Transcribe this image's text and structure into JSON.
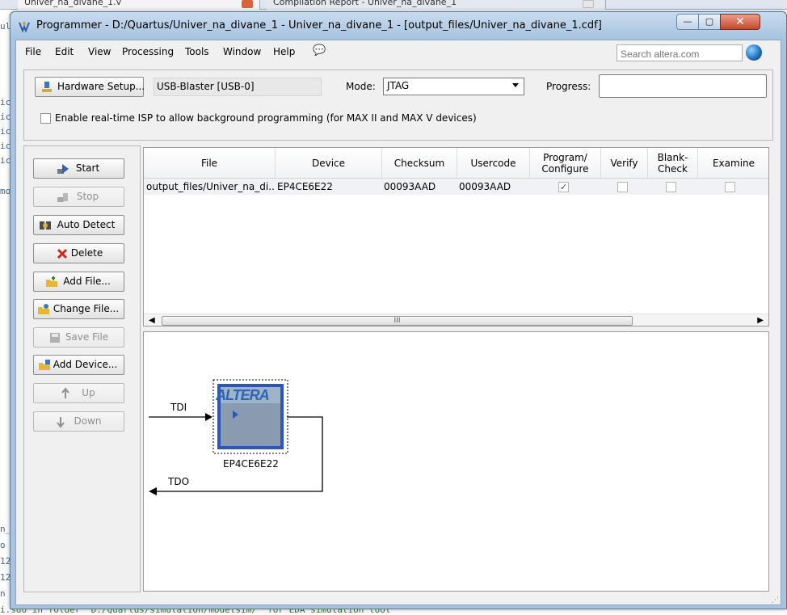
{
  "background": {
    "tab1_label": "Univer_na_divane_1.v",
    "tab2_label": "Compilation Report - Univer_na_divane_1",
    "left_gutter": [
      "ul",
      "ic",
      "ic",
      "ic",
      "ic",
      "ic",
      "mo",
      "n_",
      "o",
      "12",
      "12",
      "n"
    ],
    "console_line": "i.sdo in folder \"D:/Quartus/simulation/modelsim/\" for EDA simulation tool"
  },
  "window": {
    "title": "Programmer - D:/Quartus/Univer_na_divane_1 - Univer_na_divane_1 - [output_files/Univer_na_divane_1.cdf]",
    "min_glyph": "—",
    "max_glyph": "▢",
    "close_glyph": "✕"
  },
  "menu": {
    "items": [
      "File",
      "Edit",
      "View",
      "Processing",
      "Tools",
      "Window",
      "Help"
    ],
    "help_icon": "💬",
    "search_placeholder": "Search altera.com"
  },
  "toolbar": {
    "hardware_setup_label": "Hardware Setup...",
    "hardware_value": "USB-Blaster [USB-0]",
    "mode_label": "Mode:",
    "mode_value": "JTAG",
    "progress_label": "Progress:",
    "progress_value": 0,
    "isp_label": "Enable real-time ISP to allow background programming (for MAX II and MAX V devices)",
    "isp_checked": false
  },
  "side_buttons": [
    {
      "label": "Start",
      "enabled": true,
      "icon": "start-icon"
    },
    {
      "label": "Stop",
      "enabled": false,
      "icon": "stop-icon"
    },
    {
      "label": "Auto Detect",
      "enabled": true,
      "icon": "auto-detect-icon"
    },
    {
      "label": "Delete",
      "enabled": true,
      "icon": "delete-icon"
    },
    {
      "label": "Add File...",
      "enabled": true,
      "icon": "add-file-icon"
    },
    {
      "label": "Change File...",
      "enabled": true,
      "icon": "change-file-icon"
    },
    {
      "label": "Save File",
      "enabled": false,
      "icon": "save-file-icon"
    },
    {
      "label": "Add Device...",
      "enabled": true,
      "icon": "add-device-icon"
    },
    {
      "label": "Up",
      "enabled": false,
      "icon": "up-icon"
    },
    {
      "label": "Down",
      "enabled": false,
      "icon": "down-icon"
    }
  ],
  "table": {
    "headers": [
      "File",
      "Device",
      "Checksum",
      "Usercode",
      "Program/\nConfigure",
      "Verify",
      "Blank-\nCheck",
      "Examine"
    ],
    "rows": [
      {
        "file": "output_files/Univer_na_di...",
        "device": "EP4CE6E22",
        "checksum": "00093AAD",
        "usercode": "00093AAD",
        "program": true,
        "verify": false,
        "blank_check": false,
        "examine": false
      }
    ],
    "scroll_grip": "III"
  },
  "chain": {
    "tdi": "TDI",
    "tdo": "TDO",
    "chip_name": "EP4CE6E22",
    "chip_logo": "ALTERA"
  },
  "colors": {
    "title_bar": "#a7c2de",
    "close_button": "#c8452b",
    "chip": "#8a9bb0",
    "altera_logo": "#2f63b6"
  }
}
